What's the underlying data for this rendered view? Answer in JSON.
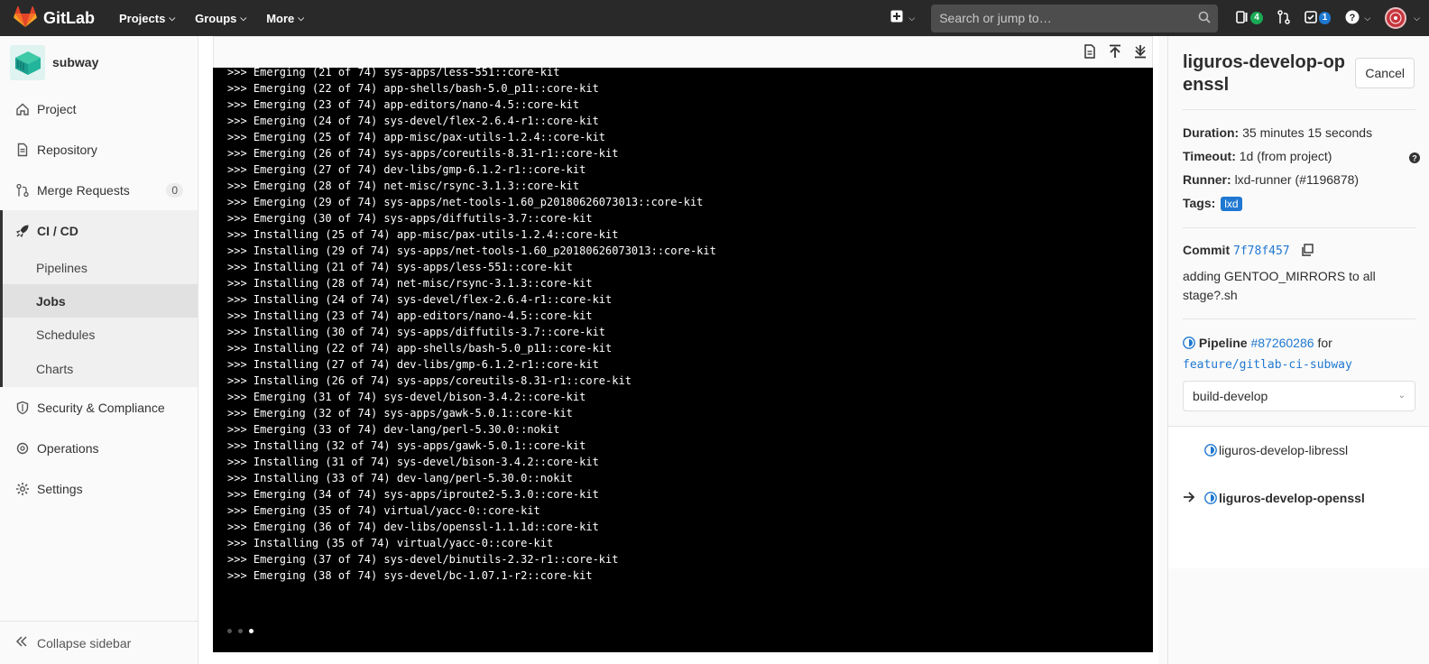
{
  "navbar": {
    "brand": "GitLab",
    "menu": [
      {
        "label": "Projects"
      },
      {
        "label": "Groups"
      },
      {
        "label": "More"
      }
    ],
    "search_placeholder": "Search or jump to…",
    "issues_count": "4",
    "todos_count": "1",
    "accent_green": "#1aaa55",
    "accent_blue": "#1f78d1"
  },
  "sidebar": {
    "project_name": "subway",
    "items": [
      {
        "label": "Project",
        "icon": "home-icon"
      },
      {
        "label": "Repository",
        "icon": "document-icon"
      },
      {
        "label": "Merge Requests",
        "icon": "merge-request-icon",
        "count": "0"
      }
    ],
    "active_group": {
      "label": "CI / CD",
      "icon": "rocket-icon",
      "subitems": [
        {
          "label": "Pipelines"
        },
        {
          "label": "Jobs"
        },
        {
          "label": "Schedules"
        },
        {
          "label": "Charts"
        }
      ]
    },
    "lower_items": [
      {
        "label": "Security & Compliance",
        "icon": "shield-icon"
      },
      {
        "label": "Operations",
        "icon": "cloud-gear-icon"
      },
      {
        "label": "Settings",
        "icon": "gear-icon"
      }
    ],
    "collapse_label": "Collapse sidebar"
  },
  "log": {
    "lines": [
      ">>> Emerging (21 of 74) sys-apps/less-551::core-kit",
      ">>> Emerging (22 of 74) app-shells/bash-5.0_p11::core-kit",
      ">>> Emerging (23 of 74) app-editors/nano-4.5::core-kit",
      ">>> Emerging (24 of 74) sys-devel/flex-2.6.4-r1::core-kit",
      ">>> Emerging (25 of 74) app-misc/pax-utils-1.2.4::core-kit",
      ">>> Emerging (26 of 74) sys-apps/coreutils-8.31-r1::core-kit",
      ">>> Emerging (27 of 74) dev-libs/gmp-6.1.2-r1::core-kit",
      ">>> Emerging (28 of 74) net-misc/rsync-3.1.3::core-kit",
      ">>> Emerging (29 of 74) sys-apps/net-tools-1.60_p20180626073013::core-kit",
      ">>> Emerging (30 of 74) sys-apps/diffutils-3.7::core-kit",
      ">>> Installing (25 of 74) app-misc/pax-utils-1.2.4::core-kit",
      ">>> Installing (29 of 74) sys-apps/net-tools-1.60_p20180626073013::core-kit",
      ">>> Installing (21 of 74) sys-apps/less-551::core-kit",
      ">>> Installing (28 of 74) net-misc/rsync-3.1.3::core-kit",
      ">>> Installing (24 of 74) sys-devel/flex-2.6.4-r1::core-kit",
      ">>> Installing (23 of 74) app-editors/nano-4.5::core-kit",
      ">>> Installing (30 of 74) sys-apps/diffutils-3.7::core-kit",
      ">>> Installing (22 of 74) app-shells/bash-5.0_p11::core-kit",
      ">>> Installing (27 of 74) dev-libs/gmp-6.1.2-r1::core-kit",
      ">>> Installing (26 of 74) sys-apps/coreutils-8.31-r1::core-kit",
      ">>> Emerging (31 of 74) sys-devel/bison-3.4.2::core-kit",
      ">>> Emerging (32 of 74) sys-apps/gawk-5.0.1::core-kit",
      ">>> Emerging (33 of 74) dev-lang/perl-5.30.0::nokit",
      ">>> Installing (32 of 74) sys-apps/gawk-5.0.1::core-kit",
      ">>> Installing (31 of 74) sys-devel/bison-3.4.2::core-kit",
      ">>> Installing (33 of 74) dev-lang/perl-5.30.0::nokit",
      ">>> Emerging (34 of 74) sys-apps/iproute2-5.3.0::core-kit",
      ">>> Emerging (35 of 74) virtual/yacc-0::core-kit",
      ">>> Emerging (36 of 74) dev-libs/openssl-1.1.1d::core-kit",
      ">>> Installing (35 of 74) virtual/yacc-0::core-kit",
      ">>> Emerging (37 of 74) sys-devel/binutils-2.32-r1::core-kit",
      ">>> Emerging (38 of 74) sys-devel/bc-1.07.1-r2::core-kit"
    ]
  },
  "job": {
    "title": "liguros-develop-openssl",
    "cancel_label": "Cancel",
    "duration_label": "Duration:",
    "duration_value": "35 minutes 15 seconds",
    "timeout_label": "Timeout:",
    "timeout_value": "1d (from project)",
    "runner_label": "Runner:",
    "runner_value": "lxd-runner (#1196878)",
    "tags_label": "Tags:",
    "tag": "lxd",
    "commit_label": "Commit",
    "commit_sha": "7f78f457",
    "commit_message": "adding GENTOO_MIRRORS to all stage?.sh",
    "pipeline_label": "Pipeline",
    "pipeline_id": "#87260286",
    "pipeline_for": "for",
    "branch": "feature/gitlab-ci-subway",
    "stage_selected": "build-develop",
    "stage_jobs": [
      {
        "label": "liguros-develop-libressl",
        "current": false
      },
      {
        "label": "liguros-develop-openssl",
        "current": true
      }
    ]
  }
}
